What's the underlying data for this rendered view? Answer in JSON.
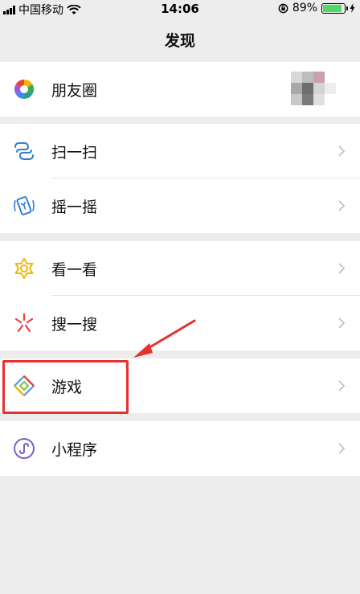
{
  "status_bar": {
    "carrier": "中国移动",
    "time": "14:06",
    "battery_percent": "89%",
    "battery_level": 0.89,
    "icons": [
      "signal-icon",
      "wifi-icon",
      "orientation-lock-icon",
      "battery-icon",
      "charging-icon"
    ]
  },
  "nav": {
    "title": "发现"
  },
  "items": {
    "moments": {
      "label": "朋友圈",
      "icon": "moments-icon"
    },
    "scan": {
      "label": "扫一扫",
      "icon": "scan-icon"
    },
    "shake": {
      "label": "摇一摇",
      "icon": "shake-icon"
    },
    "top_stories": {
      "label": "看一看",
      "icon": "top-stories-icon"
    },
    "search": {
      "label": "搜一搜",
      "icon": "search-icon"
    },
    "games": {
      "label": "游戏",
      "icon": "games-icon"
    },
    "mini_programs": {
      "label": "小程序",
      "icon": "mini-programs-icon"
    }
  },
  "colors": {
    "background": "#ededed",
    "cell": "#ffffff",
    "annotation_red": "#e8302f",
    "chevron": "#c7c7cc",
    "battery_green": "#4cd964"
  }
}
